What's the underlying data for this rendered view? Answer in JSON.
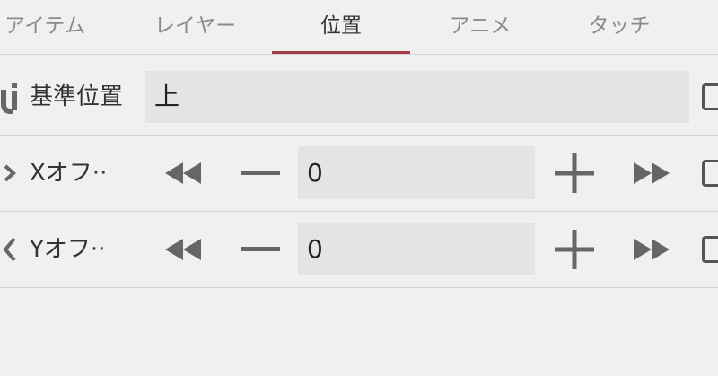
{
  "tabs": [
    {
      "label": "アイテム",
      "active": false
    },
    {
      "label": "レイヤー",
      "active": false
    },
    {
      "label": "位置",
      "active": true
    },
    {
      "label": "アニメ",
      "active": false
    },
    {
      "label": "タッチ",
      "active": false
    }
  ],
  "colors": {
    "background": "#f0f0f0",
    "active_tab_underline": "#a33b45",
    "field_background": "#e4e4e4",
    "icon_gray": "#666666"
  },
  "rows": {
    "anchor": {
      "label": "基準位置",
      "value": "上",
      "icon": "anchor-position-icon"
    },
    "x_offset": {
      "label": "Xオフ··",
      "value": "0",
      "icon": "chevron-right-icon",
      "buttons": [
        "fast-decrease-icon",
        "decrease-icon",
        "increase-icon",
        "fast-increase-icon"
      ]
    },
    "y_offset": {
      "label": "Yオフ··",
      "value": "0",
      "icon": "chevron-vertical-icon",
      "buttons": [
        "fast-decrease-icon",
        "decrease-icon",
        "increase-icon",
        "fast-increase-icon"
      ]
    }
  }
}
